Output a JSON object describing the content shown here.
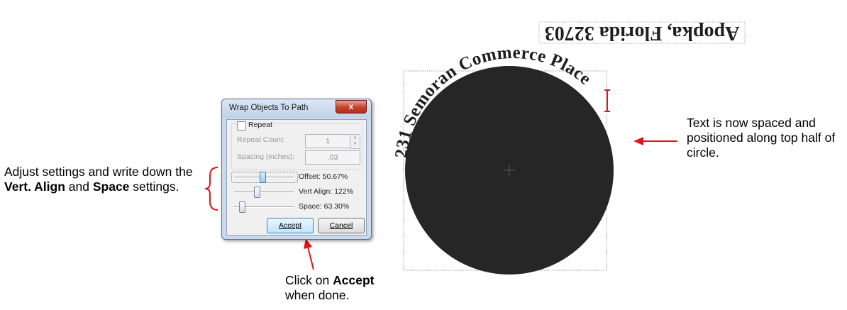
{
  "annotations": {
    "left_prefix": "Adjust settings and write down the ",
    "left_bold1": "Vert. Align",
    "left_mid": " and ",
    "left_bold2": "Space",
    "left_suffix": " settings.",
    "right": "Text is now spaced and positioned along top half of circle.",
    "bottom_prefix": "Click on ",
    "bottom_bold": "Accept",
    "bottom_suffix": " when done."
  },
  "dialog": {
    "title": "Wrap Objects To Path",
    "close_glyph": "x",
    "repeat_label": "Repeat",
    "repeat_checked": false,
    "repeat_count_label": "Repeat Count:",
    "repeat_count_value": "1",
    "spacing_label": "Spacing (inches):",
    "spacing_value": ".03",
    "offset_label": "Offset: 50.67%",
    "vert_align_label": "Vert Align: 122%",
    "space_label": "Space: 63.30%",
    "offset_fraction": 0.5067,
    "accept_label": "Accept",
    "cancel_label": "Cancel"
  },
  "canvas": {
    "upside_down_text": "Apopka, Florida 32703",
    "arc_text": "231 Semoran Commerce Place",
    "circle_color": "#262626",
    "arrow_color": "#e0141b"
  }
}
